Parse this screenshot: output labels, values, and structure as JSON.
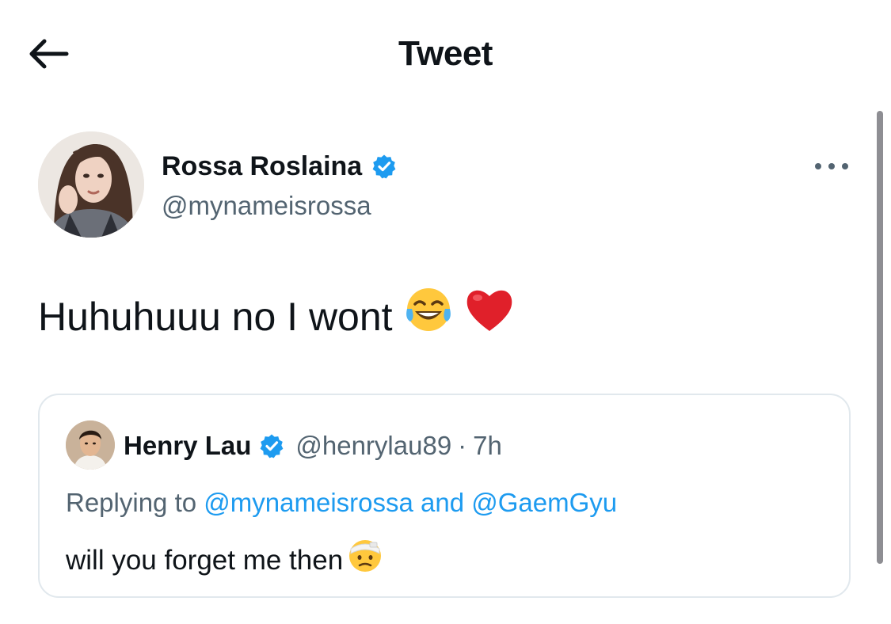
{
  "header": {
    "title": "Tweet",
    "back_icon": "arrow-left-icon"
  },
  "tweet": {
    "author_name": "Rossa Roslaina",
    "author_handle": "@mynameisrossa",
    "verified": true,
    "text": "Huhuhuuu no I wont",
    "emojis": [
      "face-with-tears-of-joy-icon",
      "red-heart-icon"
    ],
    "more_icon": "more-horizontal-icon"
  },
  "quoted_tweet": {
    "author_name": "Henry Lau",
    "author_handle": "@henrylau89",
    "separator": "·",
    "time": "7h",
    "verified": true,
    "replying_prefix": "Replying to",
    "mention_1": "@mynameisrossa",
    "conjunction": "and",
    "mention_2": "@GaemGyu",
    "text": "will you forget me then",
    "emoji": "face-with-head-bandage-icon"
  },
  "colors": {
    "text": "#0f1419",
    "secondary": "#536471",
    "link": "#1d9bf0",
    "verified": "#1d9bf0",
    "border": "#e1e8ed"
  }
}
